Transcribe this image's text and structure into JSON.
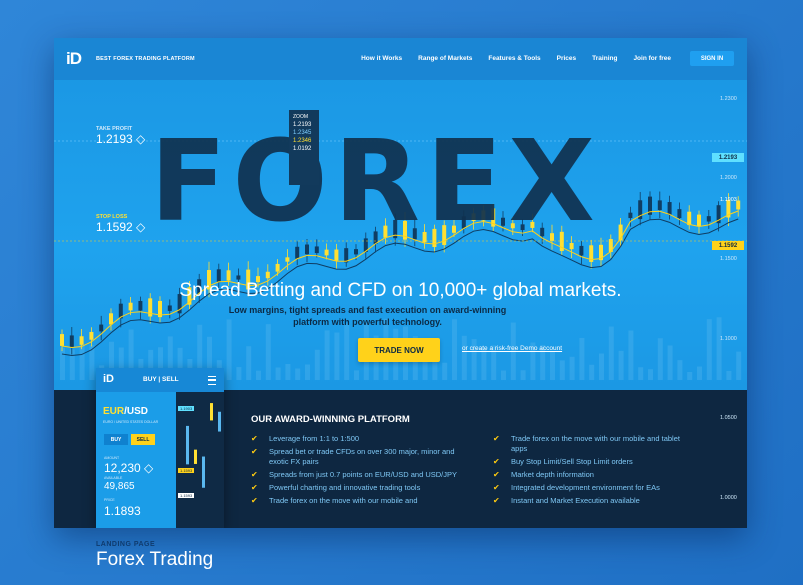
{
  "nav": {
    "logo": "iD",
    "tagline": "BEST FOREX TRADING PLATFORM",
    "items": [
      "How it Works",
      "Range of Markets",
      "Features & Tools",
      "Prices",
      "Training",
      "Join for free"
    ],
    "signin": "SIGN IN"
  },
  "hero": {
    "big_word": "FOREX",
    "headline": "Spread Betting and CFD on 10,000+ global markets.",
    "sub_line1": "Low margins, tight spreads and fast execution on award-winning",
    "sub_line2": "platform with powerful technology.",
    "cta": "TRADE NOW",
    "demo_link": "or create a risk-free Demo account",
    "take_profit_label": "TAKE PROFIT",
    "take_profit_value": "1.2193 ◇",
    "stop_loss_label": "STOP LOSS",
    "stop_loss_value": "1.1592 ◇",
    "zoom": {
      "label": "ZOOM",
      "values": [
        "1.2193",
        "1.2345",
        "1.2346",
        "1.0192"
      ]
    },
    "right_axis": [
      "1.2300",
      "1.2000",
      "1.1903",
      "1.1500",
      "1.1000",
      "1.0500",
      "1.0000"
    ],
    "tag_up": "1.2193",
    "tag_down": "1.1592"
  },
  "platform": {
    "title": "OUR AWARD-WINNING PLATFORM",
    "left": [
      "Leverage from 1:1 to 1:500",
      "Spread bet or trade CFDs on over 300 major, minor and exotic FX pairs",
      "Spreads from just 0.7 points on EUR/USD and USD/JPY",
      "Powerful charting and innovative trading tools",
      "Trade forex on the move with our mobile and"
    ],
    "right": [
      "Trade forex on the move with our mobile and tablet apps",
      "Buy Stop Limit/Sell Stop Limit orders",
      "Market depth information",
      "Integrated development environment for EAs",
      "Instant and Market Execution available"
    ]
  },
  "mobile": {
    "logo": "iD",
    "buy_sell": "BUY | SELL",
    "pair_a": "EUR",
    "pair_b": "/USD",
    "pair_sub": "EURO / UNITED STATES DOLLAR",
    "buy": "BUY",
    "sell": "SELL",
    "amount_label": "AMOUNT",
    "amount": "12,230 ◇",
    "available_label": "AVAILABLE",
    "available": "49,865",
    "price_label": "PRICE",
    "price": "1.1893",
    "mini_tags": [
      "1.1903",
      "1.1593",
      "1.1593"
    ]
  },
  "caption": {
    "kicker": "LANDING PAGE",
    "title": "Forex Trading"
  },
  "colors": {
    "accent": "#ffd21a",
    "hero_blue": "#1d9be6",
    "dark_navy": "#0e2741"
  }
}
